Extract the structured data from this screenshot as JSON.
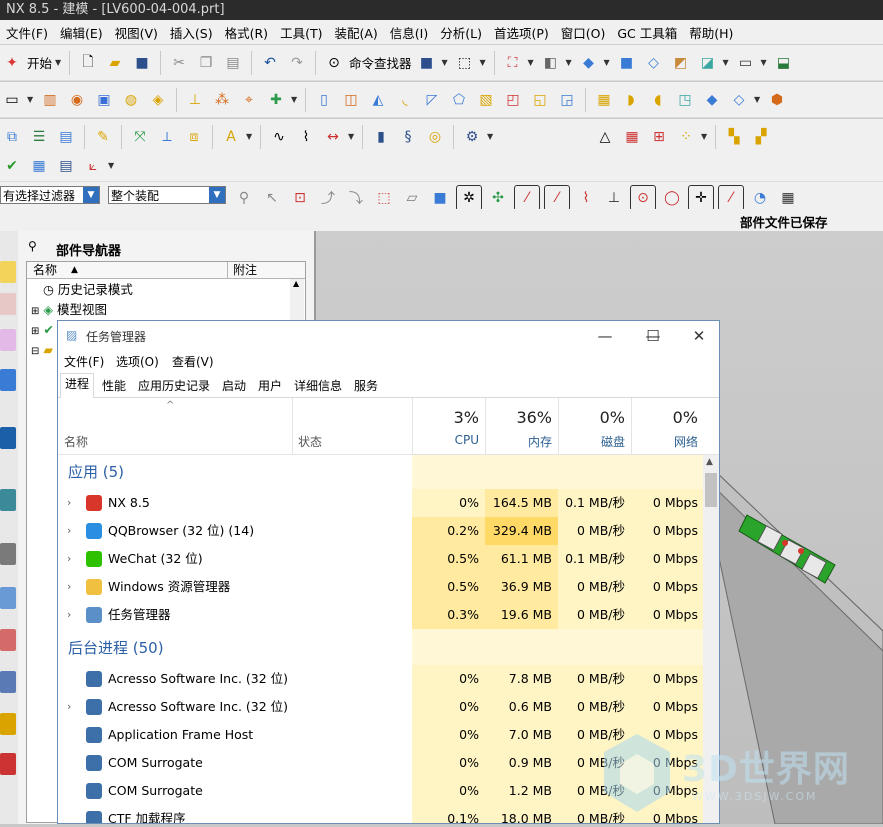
{
  "nx": {
    "window_title": "NX 8.5 - 建模 - [LV600-04-004.prt]",
    "menu": [
      "文件(F)",
      "编辑(E)",
      "视图(V)",
      "插入(S)",
      "格式(R)",
      "工具(T)",
      "装配(A)",
      "信息(I)",
      "分析(L)",
      "首选项(P)",
      "窗口(O)",
      "GC 工具箱",
      "帮助(H)"
    ],
    "toolbar": {
      "start_label": "开始",
      "command_finder_label": "命令查找器"
    },
    "filter": {
      "selection_filter": "有选择过滤器",
      "scope": "整个装配"
    },
    "status": "部件文件已保存",
    "part_navigator": {
      "title": "部件导航器",
      "col_name": "名称",
      "col_note": "附注",
      "rows": [
        "历史记录模式",
        "模型视图"
      ]
    }
  },
  "task_manager": {
    "title": "任务管理器",
    "menu": [
      "文件(F)",
      "选项(O)",
      "查看(V)"
    ],
    "tabs": [
      "进程",
      "性能",
      "应用历史记录",
      "启动",
      "用户",
      "详细信息",
      "服务"
    ],
    "active_tab": "进程",
    "columns": {
      "name": "名称",
      "status": "状态",
      "cpu": {
        "pct": "3%",
        "label": "CPU"
      },
      "mem": {
        "pct": "36%",
        "label": "内存"
      },
      "disk": {
        "pct": "0%",
        "label": "磁盘"
      },
      "net": {
        "pct": "0%",
        "label": "网络"
      }
    },
    "groups": [
      {
        "title": "应用 (5)",
        "rows": [
          {
            "name": "NX 8.5",
            "cpu": "0%",
            "mem": "164.5 MB",
            "disk": "0.1 MB/秒",
            "net": "0 Mbps",
            "expand": true,
            "icon_color": "#d9362b"
          },
          {
            "name": "QQBrowser (32 位) (14)",
            "cpu": "0.2%",
            "mem": "329.4 MB",
            "disk": "0 MB/秒",
            "net": "0 Mbps",
            "expand": true,
            "icon_color": "#2a8fe0"
          },
          {
            "name": "WeChat (32 位)",
            "cpu": "0.5%",
            "mem": "61.1 MB",
            "disk": "0.1 MB/秒",
            "net": "0 Mbps",
            "expand": true,
            "icon_color": "#2dc100"
          },
          {
            "name": "Windows 资源管理器",
            "cpu": "0.5%",
            "mem": "36.9 MB",
            "disk": "0 MB/秒",
            "net": "0 Mbps",
            "expand": true,
            "icon_color": "#f0c040"
          },
          {
            "name": "任务管理器",
            "cpu": "0.3%",
            "mem": "19.6 MB",
            "disk": "0 MB/秒",
            "net": "0 Mbps",
            "expand": true,
            "icon_color": "#5a8fc8"
          }
        ]
      },
      {
        "title": "后台进程 (50)",
        "rows": [
          {
            "name": "Acresso Software Inc. (32 位)",
            "cpu": "0%",
            "mem": "7.8 MB",
            "disk": "0 MB/秒",
            "net": "0 Mbps",
            "expand": false,
            "icon_color": "#3d6fa8"
          },
          {
            "name": "Acresso Software Inc. (32 位)",
            "cpu": "0%",
            "mem": "0.6 MB",
            "disk": "0 MB/秒",
            "net": "0 Mbps",
            "expand": true,
            "icon_color": "#3d6fa8"
          },
          {
            "name": "Application Frame Host",
            "cpu": "0%",
            "mem": "7.0 MB",
            "disk": "0 MB/秒",
            "net": "0 Mbps",
            "expand": false,
            "icon_color": "#3d6fa8"
          },
          {
            "name": "COM Surrogate",
            "cpu": "0%",
            "mem": "0.9 MB",
            "disk": "0 MB/秒",
            "net": "0 Mbps",
            "expand": false,
            "icon_color": "#3d6fa8"
          },
          {
            "name": "COM Surrogate",
            "cpu": "0%",
            "mem": "1.2 MB",
            "disk": "0 MB/秒",
            "net": "0 Mbps",
            "expand": false,
            "icon_color": "#3d6fa8"
          },
          {
            "name": "CTF 加载程序",
            "cpu": "0.1%",
            "mem": "18.0 MB",
            "disk": "0 MB/秒",
            "net": "0 Mbps",
            "expand": false,
            "icon_color": "#3d6fa8"
          }
        ]
      }
    ]
  },
  "watermark": {
    "text": "3D世界网",
    "url": "WWW.3DSJW.COM"
  },
  "colors": {
    "heat_light": "#fff4c4",
    "heat_mid": "#ffeaa0",
    "heat_strong": "#ffd966",
    "group_title": "#2b5fa6"
  }
}
